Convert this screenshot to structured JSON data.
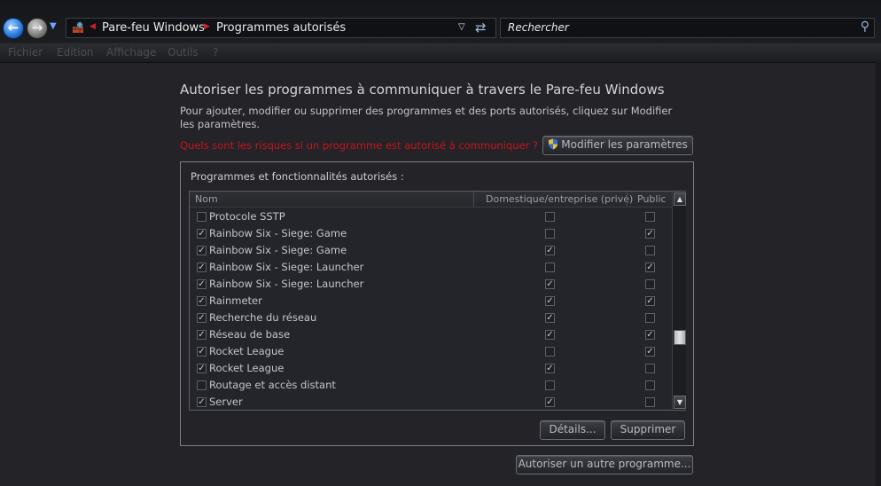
{
  "address_bar": {
    "crumbs": [
      "Pare-feu Windows",
      "Programmes autorisés"
    ],
    "search_placeholder": "Rechercher"
  },
  "menu": [
    "Fichier",
    "Edition",
    "Affichage",
    "Outils",
    "?"
  ],
  "content": {
    "heading": "Autoriser les programmes à communiquer à travers le Pare-feu Windows",
    "description": "Pour ajouter, modifier ou supprimer des programmes et des ports autorisés, cliquez sur Modifier les paramètres.",
    "risk_link": "Quels sont les risques si un programme est autorisé à communiquer ?",
    "modify_button": "Modifier les paramètres",
    "group_title": "Programmes et fonctionnalités autorisés :",
    "columns": [
      "Nom",
      "Domestique/entreprise (privé)",
      "Public"
    ],
    "rows": [
      {
        "name": "Protocole SSTP",
        "enabled": false,
        "private": false,
        "public": false
      },
      {
        "name": "Rainbow Six - Siege: Game",
        "enabled": true,
        "private": false,
        "public": true
      },
      {
        "name": "Rainbow Six - Siege: Game",
        "enabled": true,
        "private": true,
        "public": false
      },
      {
        "name": "Rainbow Six - Siege: Launcher",
        "enabled": true,
        "private": false,
        "public": true
      },
      {
        "name": "Rainbow Six - Siege: Launcher",
        "enabled": true,
        "private": true,
        "public": false
      },
      {
        "name": "Rainmeter",
        "enabled": true,
        "private": true,
        "public": true
      },
      {
        "name": "Recherche du réseau",
        "enabled": true,
        "private": true,
        "public": false
      },
      {
        "name": "Réseau de base",
        "enabled": true,
        "private": true,
        "public": true
      },
      {
        "name": "Rocket League",
        "enabled": true,
        "private": false,
        "public": true
      },
      {
        "name": "Rocket League",
        "enabled": true,
        "private": true,
        "public": false
      },
      {
        "name": "Routage et accès distant",
        "enabled": false,
        "private": false,
        "public": false
      },
      {
        "name": "Server",
        "enabled": true,
        "private": true,
        "public": false
      }
    ],
    "details_button": "Détails...",
    "delete_button": "Supprimer",
    "allow_other_button": "Autoriser un autre programme..."
  }
}
